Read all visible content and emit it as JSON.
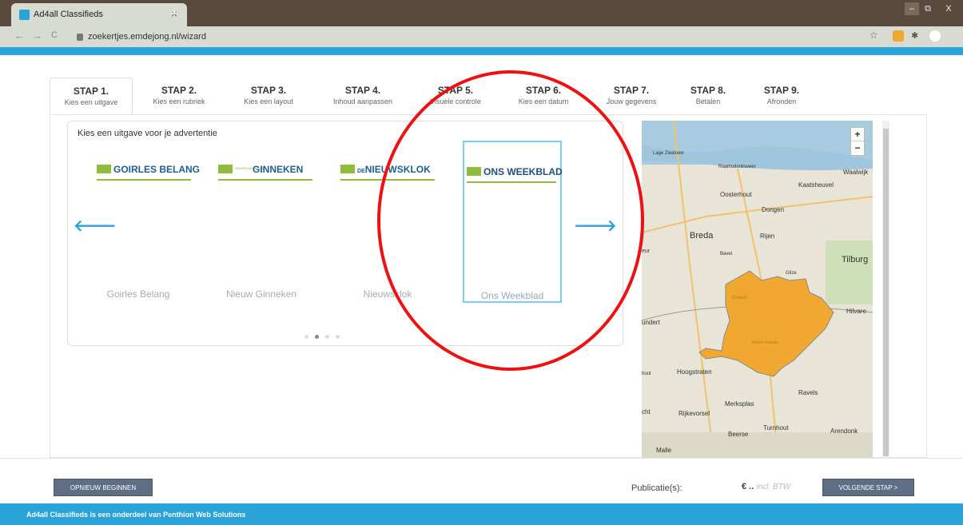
{
  "browser": {
    "tab_title": "Ad4all Classifieds",
    "tab_close": "×",
    "new_tab": "+",
    "url": "zoekertjes.emdejong.nl/wizard",
    "back": "←",
    "forward": "→",
    "reload": "C",
    "minimize": "–",
    "restore": "⧉",
    "close": "X"
  },
  "steps": [
    {
      "num": "STAP 1.",
      "label": "Kies een uitgave"
    },
    {
      "num": "STAP 2.",
      "label": "Kies een rubriek"
    },
    {
      "num": "STAP 3.",
      "label": "Kies een layout"
    },
    {
      "num": "STAP 4.",
      "label": "Inhoud aanpassen"
    },
    {
      "num": "STAP 5.",
      "label": "Visuele controle"
    },
    {
      "num": "STAP 6.",
      "label": "Kies een datum"
    },
    {
      "num": "STAP 7.",
      "label": "Jouw gegevens"
    },
    {
      "num": "STAP 8.",
      "label": "Betalen"
    },
    {
      "num": "STAP 9.",
      "label": "Afronden"
    }
  ],
  "carousel": {
    "title": "Kies een uitgave voor je advertentie",
    "prev": "🡐",
    "next": "🡒",
    "publications": [
      {
        "logo": "GOIRLES BELANG",
        "name": "Goirles Belang"
      },
      {
        "logo": "GINNEKEN",
        "logo_prefix": "WEEKBLAD NIEUW",
        "name": "Nieuw Ginneken"
      },
      {
        "logo": "NIEUWSKLOK",
        "logo_prefix": "DE",
        "name": "Nieuwsklok"
      },
      {
        "logo": "ONS WEEKBLAD",
        "name": "Ons Weekblad"
      }
    ],
    "active_dot": 1
  },
  "map": {
    "zoom_in": "+",
    "zoom_out": "−",
    "places": [
      "Lage Zwaluwe",
      "Raamsdonksveer",
      "Waalwijk",
      "Kaatsheuvel",
      "Oosterhout",
      "Dongen",
      "Breda",
      "Rijen",
      "Bavel",
      "Tilburg",
      "Gilze",
      "Chaam",
      "Hilvare",
      "Baarle-Nassau",
      "undert",
      "Hoogstraten",
      "Ravels",
      "Merksplas",
      "Rijkevorsel",
      "Turnhout",
      "Beerse",
      "Arendonk",
      "Malle",
      "cht",
      "hout",
      "eur"
    ],
    "highlight_color": "#f0a830"
  },
  "footer": {
    "restart": "OPNIEUW BEGINNEN",
    "publications_label": "Publicatie(s):",
    "price": "€ ..",
    "vat": "incl. BTW",
    "next": "VOLGENDE STAP >",
    "credit": "Ad4all Classifieds is een onderdeel van Penthion Web Solutions"
  },
  "colors": {
    "accent": "#2aa3d9",
    "button": "#5f6e85",
    "annotation": "#e11111"
  }
}
